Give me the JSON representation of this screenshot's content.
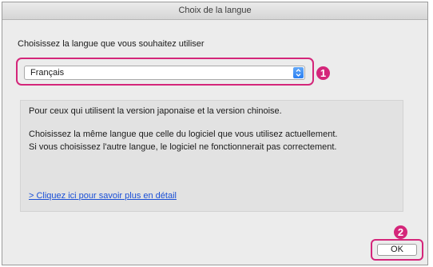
{
  "window": {
    "title": "Choix de la langue"
  },
  "prompt": "Choisissez la langue que vous souhaitez utiliser",
  "language_select": {
    "selected": "Français"
  },
  "callouts": {
    "one": "1",
    "two": "2"
  },
  "info": {
    "line1": "Pour ceux qui utilisent la version japonaise et la version chinoise.",
    "line2": "Choisissez la même langue que celle du logiciel que vous utilisez actuellement.",
    "line3": "Si vous choisissez l'autre langue, le logiciel ne fonctionnerait pas correctement.",
    "link": "> Cliquez ici pour savoir plus en détail"
  },
  "buttons": {
    "ok_label": "OK"
  },
  "colors": {
    "callout": "#d4267a",
    "link": "#1a4fd6",
    "stepper": "#2a7ef2"
  },
  "icons": {
    "select_stepper": "up-down-chevron-icon"
  }
}
